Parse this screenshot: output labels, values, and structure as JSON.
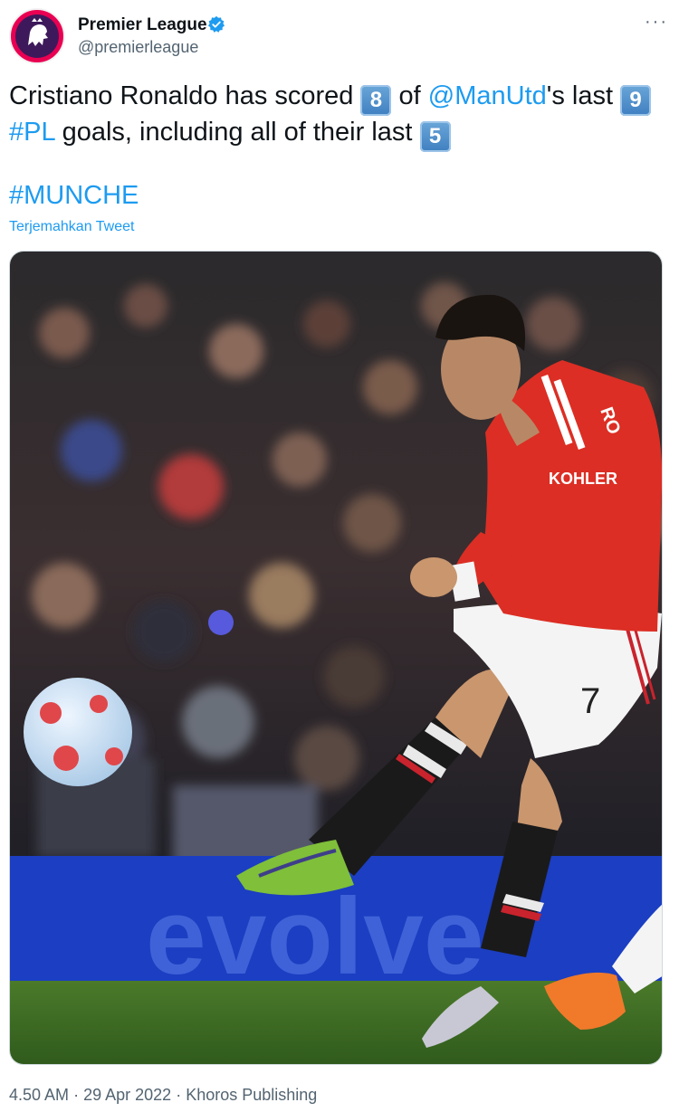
{
  "author": {
    "name": "Premier League",
    "handle": "@premierleague",
    "verified": true,
    "avatar_icon": "premier-league-lion-logo",
    "brand_color": "#3d195b",
    "accent_color": "#e90052"
  },
  "more_label": "···",
  "tweet": {
    "t1": "Cristiano Ronaldo has scored ",
    "k1": "8",
    "t2": " of ",
    "mention": "@ManUtd",
    "t3": "'s last ",
    "k2": "9",
    "hashtag_pl": "#PL",
    "t4": " goals, including all of their last ",
    "k3": "5",
    "hashtag_match": "#MUNCHE",
    "translate_label": "Terjemahkan Tweet"
  },
  "photo": {
    "shirt_sponsor": "KOHLER",
    "shirt_name": "RO",
    "shirt_number": "7",
    "board_text": "evolve"
  },
  "footer": {
    "time": "4.50 AM",
    "date": "29 Apr 2022",
    "source": "Khoros Publishing",
    "separator": "·"
  },
  "colors": {
    "link": "#1d9bf0",
    "text": "#0f1419",
    "muted": "#536471"
  }
}
